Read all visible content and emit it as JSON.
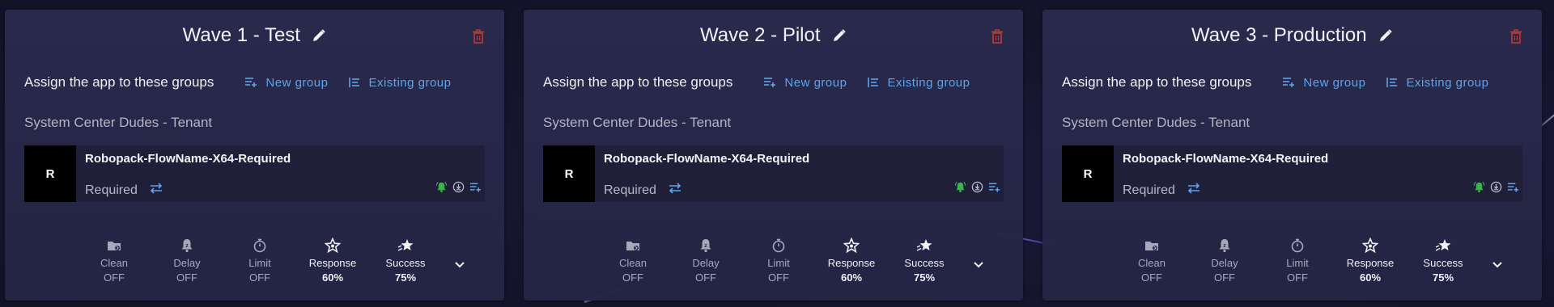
{
  "colors": {
    "accent": "#5da4ea",
    "delete": "#c0392b",
    "success_green": "#3fb24f",
    "avatar_bg": "#000000"
  },
  "cards": [
    {
      "title": "Wave 1 - Test",
      "assign_label": "Assign the app to these groups",
      "new_group_label": "New group",
      "existing_group_label": "Existing group",
      "tenant": "System Center Dudes - Tenant",
      "app": {
        "avatar": "R",
        "name": "Robopack-FlowName-X64-Required",
        "intent": "Required"
      },
      "settings": [
        {
          "icon": "folder-clean-icon",
          "label": "Clean",
          "value": "OFF"
        },
        {
          "icon": "bell-delay-icon",
          "label": "Delay",
          "value": "OFF"
        },
        {
          "icon": "stopwatch-icon",
          "label": "Limit",
          "value": "OFF"
        },
        {
          "icon": "star-icon",
          "label": "Response",
          "value": "60%"
        },
        {
          "icon": "shooting-star-icon",
          "label": "Success",
          "value": "75%"
        }
      ]
    },
    {
      "title": "Wave 2 - Pilot",
      "assign_label": "Assign the app to these groups",
      "new_group_label": "New group",
      "existing_group_label": "Existing group",
      "tenant": "System Center Dudes - Tenant",
      "app": {
        "avatar": "R",
        "name": "Robopack-FlowName-X64-Required",
        "intent": "Required"
      },
      "settings": [
        {
          "icon": "folder-clean-icon",
          "label": "Clean",
          "value": "OFF"
        },
        {
          "icon": "bell-delay-icon",
          "label": "Delay",
          "value": "OFF"
        },
        {
          "icon": "stopwatch-icon",
          "label": "Limit",
          "value": "OFF"
        },
        {
          "icon": "star-icon",
          "label": "Response",
          "value": "60%"
        },
        {
          "icon": "shooting-star-icon",
          "label": "Success",
          "value": "75%"
        }
      ]
    },
    {
      "title": "Wave 3 - Production",
      "assign_label": "Assign the app to these groups",
      "new_group_label": "New group",
      "existing_group_label": "Existing group",
      "tenant": "System Center Dudes - Tenant",
      "app": {
        "avatar": "R",
        "name": "Robopack-FlowName-X64-Required",
        "intent": "Required"
      },
      "settings": [
        {
          "icon": "folder-clean-icon",
          "label": "Clean",
          "value": "OFF"
        },
        {
          "icon": "bell-delay-icon",
          "label": "Delay",
          "value": "OFF"
        },
        {
          "icon": "stopwatch-icon",
          "label": "Limit",
          "value": "OFF"
        },
        {
          "icon": "star-icon",
          "label": "Response",
          "value": "60%"
        },
        {
          "icon": "shooting-star-icon",
          "label": "Success",
          "value": "75%"
        }
      ]
    }
  ]
}
